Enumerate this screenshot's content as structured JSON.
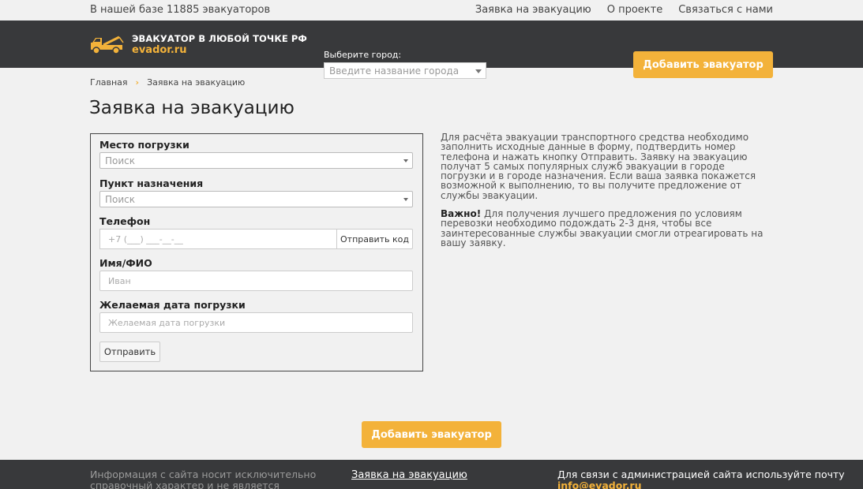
{
  "topbar": {
    "count_text": "В нашей базе 11885 эвакуаторов",
    "links": [
      "Заявка на эвакуацию",
      "О проекте",
      "Связаться с нами"
    ]
  },
  "header": {
    "logo_line1": "ЭВАКУАТОР В ЛЮБОЙ ТОЧКЕ РФ",
    "logo_line2": "evador.ru",
    "city_label": "Выберите город:",
    "city_placeholder": "Введите название города",
    "add_button": "Добавить эвакуатор"
  },
  "breadcrumbs": [
    "Главная",
    "Заявка на эвакуацию"
  ],
  "page_title": "Заявка на эвакуацию",
  "form": {
    "pickup_label": "Место погрузки",
    "pickup_value": "Поиск",
    "destination_label": "Пункт назначения",
    "destination_value": "Поиск",
    "phone_label": "Телефон",
    "phone_placeholder": "+7 (___) ___-__-__",
    "send_code_button": "Отправить код",
    "name_label": "Имя/ФИО",
    "name_placeholder": "Иван",
    "date_label": "Желаемая дата погрузки",
    "date_placeholder": "Желаемая дата погрузки",
    "submit_button": "Отправить"
  },
  "info": {
    "paragraph1": "Для расчёта эвакуации транспортного средства необходимо заполнить исходные данные в форму, подтвердить номер телефона и нажать кнопку Отправить. Заявку на эвакуацию получат 5 самых популярных служб эвакуации в городе погрузки и в городе назначения. Если ваша заявка покажется возможной к выполнению, то вы получите предложение от службы эвакуации.",
    "important_label": "Важно!",
    "paragraph2": "Для получения лучшего предложения по условиям перевозки необходимо подождать 2-3 дня, чтобы все заинтересованные службы эвакуации смогли отреагировать на вашу заявку."
  },
  "bottom_add_button": "Добавить эвакуатор",
  "footer": {
    "disclaimer": "Информация с сайта носит исключительно справочный характер и не является публичной",
    "link": "Заявка на эвакуацию",
    "contact_text": "Для связи с администрацией сайта используйте почту",
    "email": "info@evador.ru"
  },
  "colors": {
    "accent": "#f3b23a",
    "header_bg": "#38393b",
    "page_bg": "#f1f1f1"
  },
  "icons": {
    "logo": "tow-truck-icon",
    "dropdown": "caret-down-icon"
  }
}
